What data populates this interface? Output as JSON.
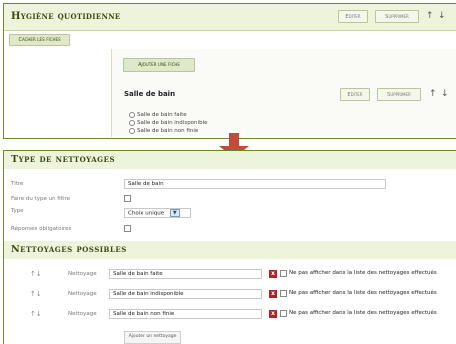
{
  "top_panel": {
    "title": "Hygiène quotidienne",
    "edit_label": "Editer",
    "delete_label": "Supprimer",
    "up_arrow": "↑",
    "down_arrow": "↓",
    "hide_cards_label": "Cacher les fiches",
    "add_card_label": "Ajouter une fiche",
    "card": {
      "title": "Salle de bain",
      "edit_label": "Editer",
      "delete_label": "Supprimer",
      "up_arrow": "↑",
      "down_arrow": "↓",
      "options": [
        "Salle de bain faite",
        "Salle de bain indisponible",
        "Salle de bain non finie"
      ]
    }
  },
  "bottom_panel": {
    "section_title": "Type de nettoyages",
    "fields": {
      "title_label": "Titre",
      "title_value": "Salle de bain",
      "filter_label": "Faire du type un filtre",
      "type_label": "Type",
      "type_value": "Choix unique",
      "required_label": "Réponses obligatoires"
    },
    "possible_title": "Nettoyages possibles",
    "rows": [
      {
        "arrows": "↑↓",
        "label": "Nettoyage",
        "value": "Salle de bain faite",
        "note": "Ne pas afficher dans la liste des nettoyages effectués"
      },
      {
        "arrows": "↑↓",
        "label": "Nettoyage",
        "value": "Salle de bain indisponible",
        "note": "Ne pas afficher dans la liste des nettoyages effectués"
      },
      {
        "arrows": "↑↓",
        "label": "Nettoyage",
        "value": "Salle de bain non finie",
        "note": "Ne pas afficher dans la liste des nettoyages effectués"
      }
    ],
    "delete_glyph": "x",
    "add_cleaning_label": "Ajouter un nettoyage"
  },
  "colors": {
    "accent": "#39480f",
    "header_bg": "#eef3dc",
    "connector": "#c44a3a",
    "delete": "#b22222"
  }
}
